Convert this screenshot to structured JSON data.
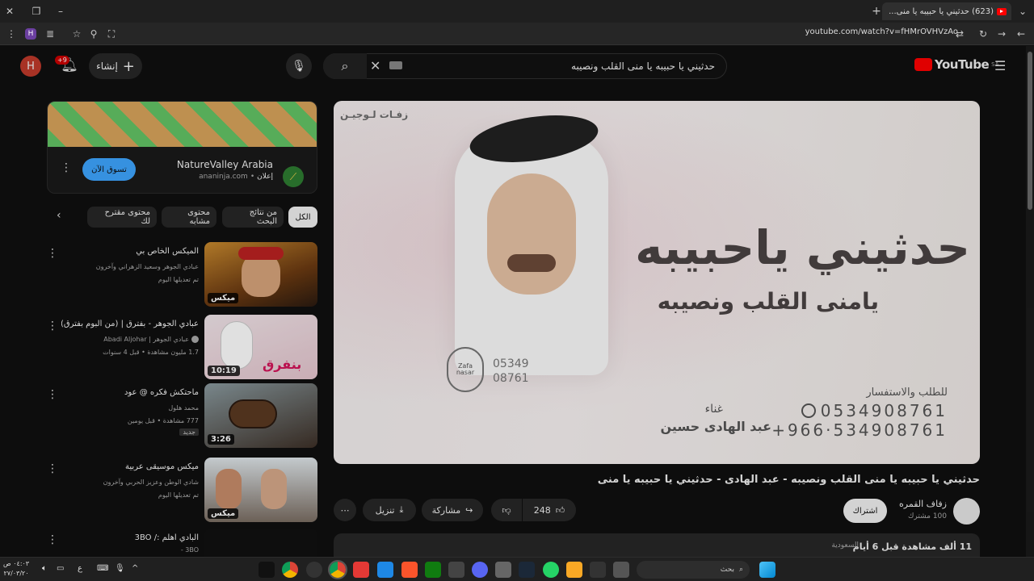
{
  "browser": {
    "tab_title": "(623) حدثيني يا حبيبه يا منى...",
    "url": "youtube.com/watch?v=fHMrOVHVzAo",
    "profile_initial": "H"
  },
  "masthead": {
    "logo_text": "YouTube",
    "region": "SA",
    "search_query": "حدثيني يا حبيبه يا منى القلب ونصيبه",
    "create_label": "إنشاء",
    "notifications": "+9",
    "avatar": "H"
  },
  "ad": {
    "advertiser": "NatureValley Arabia",
    "tag": "إعلان",
    "domain": "ananinja.com",
    "cta": "تسوق الآن"
  },
  "chips": [
    "الكل",
    "من نتائج البحث",
    "محتوى مشابه",
    "محتوى مقترح لك"
  ],
  "side": [
    {
      "title": "الميكس الخاص بي",
      "meta1": "عبادي الجوهر وسعيد الزهراني وآخرون",
      "meta2": "تم تعديلها اليوم",
      "badge": "ميكس"
    },
    {
      "title": "عبادي الجوهر - بفترق | (من ألبوم بفترق)",
      "meta1": "عبادي الجوهر | Abadi Aljohar",
      "meta2": "1.7 مليون مشاهدة • قبل 4 سنوات",
      "badge": "10:19"
    },
    {
      "title": "ماحتكش فكره @ عود",
      "meta1": "محمد هلول",
      "meta2": "777 مشاهدة • قبل يومين",
      "extra": "جديد",
      "badge": "3:26"
    },
    {
      "title": "ميكس موسيقى عربية",
      "meta1": "شادي الوطن وعزيز الحربي وآخرون",
      "meta2": "تم تعديلها اليوم",
      "badge": "ميكس"
    },
    {
      "title": "البادي اهلم :/ 3BO",
      "meta1": "3BO -",
      "meta2": "",
      "badge": ""
    }
  ],
  "video": {
    "title": "حدثيني يا حبيبه يا منى القلب ونصيبه - عبد الهادى - حدثيني يا حبيبه يا منى",
    "channel": "زفاف القمره",
    "subs": "100 مشترك",
    "subscribe": "اشتراك",
    "likes": "248",
    "share": "مشاركة",
    "download": "تنزيل",
    "views": "11 ألف مشاهدة  قبل 6 أيام",
    "region_tag": "السعودية",
    "poster": {
      "brand": "زفـات لـوجيـن",
      "big_title": "حدثيني ياحبيبه",
      "subtitle": "يامنى القلب ونصيبه",
      "phone_label": "للطلب والاستفسار",
      "phone1": "0534908761",
      "phone2": "+966·534908761",
      "singer_label": "غناء",
      "singer": "عبد الهادى حسين",
      "logo_text": "Zafa nasar",
      "code1": "05349",
      "code2": "08761"
    }
  },
  "taskbar": {
    "search_placeholder": "بحث",
    "clock_time": "٠٤:٠٣ ص",
    "clock_date": "٢٧/٠٣/٢٠"
  }
}
